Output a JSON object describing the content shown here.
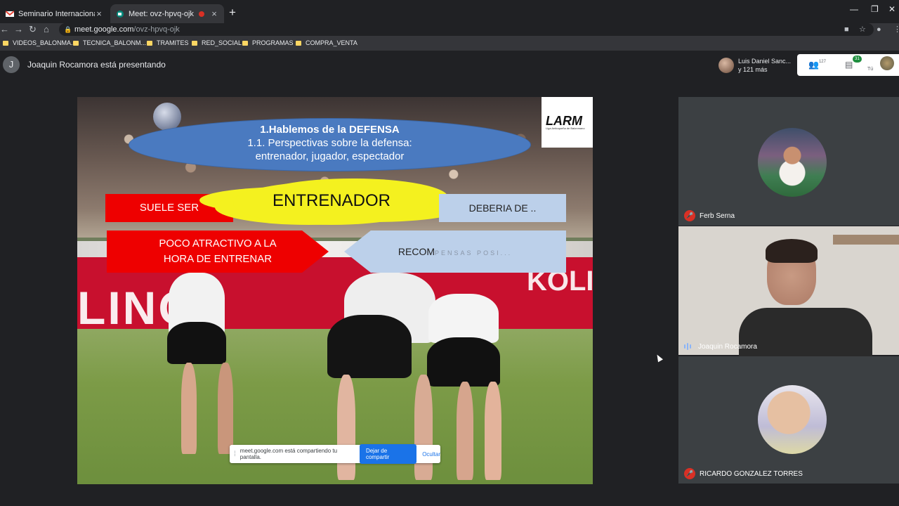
{
  "browser": {
    "tabs": [
      {
        "title": "Seminario Internacional Virtual d",
        "icon": "gmail-icon",
        "active": false
      },
      {
        "title": "Meet: ovz-hpvq-ojk",
        "icon": "meet-icon",
        "active": true
      }
    ],
    "new_tab": "+",
    "url_domain": "meet.google.com",
    "url_path": "/ovz-hpvq-ojk",
    "bookmarks": [
      "VIDEOS_BALONMA...",
      "TECNICA_BALONM...",
      "TRAMITES",
      "RED_SOCIAL",
      "PROGRAMAS",
      "COMPRA_VENTA"
    ]
  },
  "meet": {
    "presenter_initial": "J",
    "presenter_text": "Joaquin Rocamora está presentando",
    "participants_preview": {
      "line1": "Luis Daniel Sanc...",
      "line2": "y 121 más"
    },
    "people_count": "127",
    "chat_badge": "31",
    "self_label": "Tú"
  },
  "slide": {
    "ellipse_line1": "1.Hablemos de la DEFENSA",
    "ellipse_line2": "1.1. Perspectivas sobre la defensa:",
    "ellipse_line3": "entrenador, jugador, espectador",
    "logo": "LARM",
    "logo_sub": "Liga Antioqueña de Balonmano",
    "suele_ser": "SUELE SER",
    "entrenador": "ENTRENADOR",
    "deberia": "DEBERIA DE ..",
    "poco_line1": "POCO ATRACTIVO A LA",
    "poco_line2": "HORA DE ENTRENAR",
    "recompensas_main": "RECOM",
    "recompensas_fade": "PENSAS POSI...",
    "board_text": "LINO",
    "board_text2": "KOLIN"
  },
  "share_bar": {
    "message": "meet.google.com está compartiendo tu pantalla.",
    "stop_label": "Dejar de compartir",
    "hide_label": "Ocultar"
  },
  "tiles": [
    {
      "name": "Ferb Serna",
      "muted": true
    },
    {
      "name": "Joaquin Rocamora",
      "muted": false
    },
    {
      "name": "RICARDO GONZALEZ TORRES",
      "muted": true
    }
  ]
}
